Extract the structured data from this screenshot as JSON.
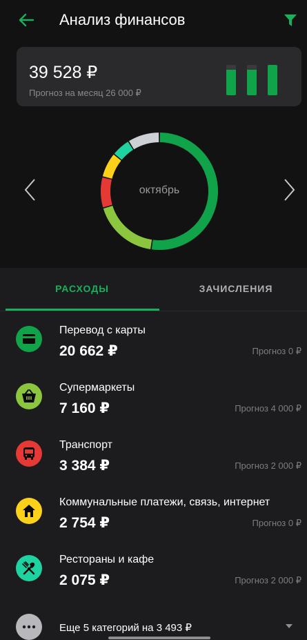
{
  "header": {
    "title": "Анализ финансов",
    "back_icon": "arrow-left-icon",
    "filter_icon": "filter-icon",
    "accent_color": "#18b05a"
  },
  "summary": {
    "amount": "39 528 ₽",
    "forecast": "Прогноз на месяц 26 000 ₽",
    "bar_levels": [
      0.85,
      0.85,
      1.0
    ]
  },
  "chart": {
    "month_label": "октябрь",
    "prev_icon": "chevron-left-icon",
    "next_icon": "chevron-right-icon",
    "segments": [
      {
        "category": "Перевод с карты",
        "value": 20662,
        "color": "#10a34a"
      },
      {
        "category": "Супермаркеты",
        "value": 7160,
        "color": "#8cc63f"
      },
      {
        "category": "Транспорт",
        "value": 3384,
        "color": "#e53935"
      },
      {
        "category": "Коммунальные платежи, связь, интернет",
        "value": 2754,
        "color": "#fdd01a"
      },
      {
        "category": "Рестораны и кафе",
        "value": 2075,
        "color": "#1fd3a0"
      },
      {
        "category": "Еще 5 категорий",
        "value": 3493,
        "color": "#cdd0d5"
      }
    ]
  },
  "tabs": {
    "expenses": "РАСХОДЫ",
    "income": "ЗАЧИСЛЕНИЯ",
    "active": "expenses"
  },
  "categories": [
    {
      "name": "Перевод с карты",
      "amount": "20 662 ₽",
      "forecast": "Прогноз 0 ₽",
      "icon": "card-icon",
      "color": "#10a34a"
    },
    {
      "name": "Супермаркеты",
      "amount": "7 160 ₽",
      "forecast": "Прогноз 4 000 ₽",
      "icon": "basket-icon",
      "color": "#8cc63f"
    },
    {
      "name": "Транспорт",
      "amount": "3 384 ₽",
      "forecast": "Прогноз 2 000 ₽",
      "icon": "bus-icon",
      "color": "#e53935"
    },
    {
      "name": "Коммунальные платежи, связь, интернет",
      "amount": "2 754 ₽",
      "forecast": "Прогноз 0 ₽",
      "icon": "house-icon",
      "color": "#fdd01a"
    },
    {
      "name": "Рестораны и кафе",
      "amount": "2 075 ₽",
      "forecast": "Прогноз 2 000 ₽",
      "icon": "fork-knife-icon",
      "color": "#1fd3a0"
    }
  ],
  "more": {
    "label": "Еще 5 категорий на 3 493 ₽",
    "icon": "more-dots-icon",
    "chevron_icon": "chevron-down-icon"
  }
}
